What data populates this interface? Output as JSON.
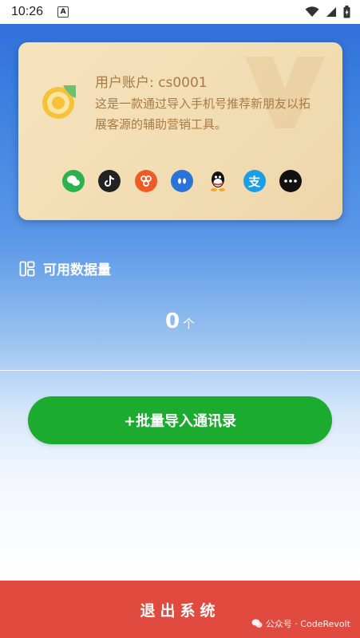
{
  "status_bar": {
    "time": "10:26",
    "notification_icon": "a-box-icon",
    "wifi_icon": "wifi-icon",
    "signal_icon": "signal-icon",
    "battery_icon": "battery-charging-icon"
  },
  "card": {
    "user_account": "用户账户: cs0001",
    "description": "这是一款通过导入手机号推荐新朋友以拓展客源的辅助营销工具。",
    "share_icons": [
      {
        "name": "wechat-icon",
        "color": "#2bb24c"
      },
      {
        "name": "tiktok-icon",
        "color": "#222222"
      },
      {
        "name": "weibo-icon",
        "color": "#f05a24"
      },
      {
        "name": "bubble-icon",
        "color": "#2b73d9"
      },
      {
        "name": "qq-icon",
        "color": "#ffffff"
      },
      {
        "name": "alipay-icon",
        "color": "#1a9fe6"
      },
      {
        "name": "more-icon",
        "color": "#111111"
      }
    ]
  },
  "data_section": {
    "label": "可用数据量",
    "value": "0",
    "unit": "个"
  },
  "import_button": {
    "label": "+批量导入通讯录"
  },
  "logout_button": {
    "label": "退出系统"
  },
  "watermark": {
    "text": "公众号 · CodeRevolt"
  },
  "colors": {
    "accent_green": "#1aab2f",
    "logout_red": "#e04a3f",
    "card_text": "#a97a44"
  }
}
